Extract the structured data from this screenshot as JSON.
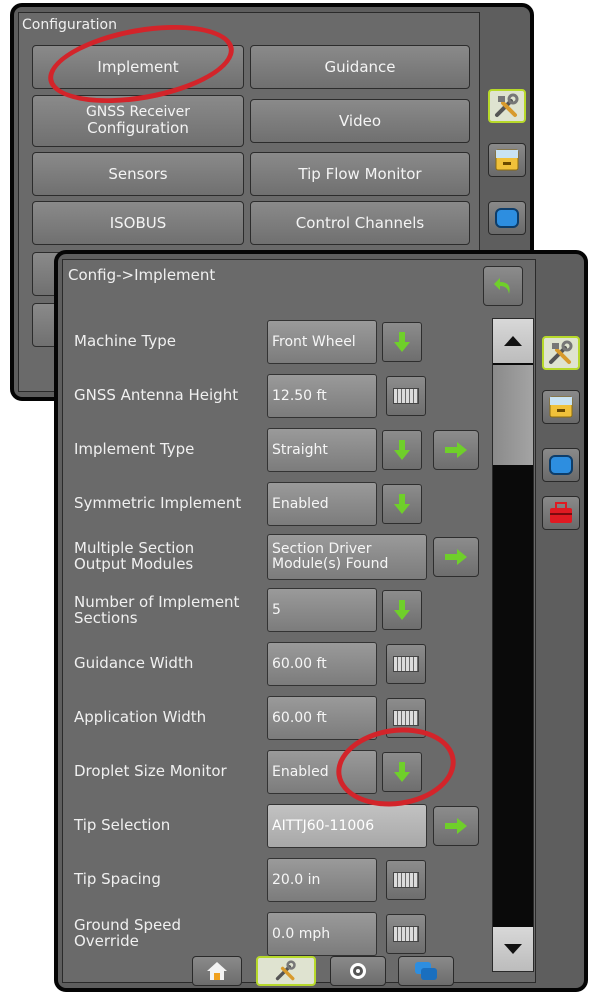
{
  "back_screen": {
    "title": "Configuration",
    "buttons": {
      "implement": "Implement",
      "guidance": "Guidance",
      "gnss_line1": "GNSS Receiver",
      "gnss_line2": "Configuration",
      "video": "Video",
      "sensors": "Sensors",
      "tip_flow_monitor": "Tip Flow Monitor",
      "isobus": "ISOBUS",
      "control_channels": "Control Channels"
    }
  },
  "front_screen": {
    "breadcrumb": "Config->Implement",
    "rows": [
      {
        "label": "Machine Type",
        "value": "Front Wheel"
      },
      {
        "label": "GNSS Antenna Height",
        "value": "12.50 ft"
      },
      {
        "label": "Implement Type",
        "value": "Straight"
      },
      {
        "label": "Symmetric Implement",
        "value": "Enabled"
      },
      {
        "label": "Multiple Section Output Modules",
        "value": "Section Driver Module(s) Found"
      },
      {
        "label": "Number of Implement Sections",
        "value": "5"
      },
      {
        "label": "Guidance Width",
        "value": "60.00 ft"
      },
      {
        "label": "Application Width",
        "value": "60.00 ft"
      },
      {
        "label": "Droplet Size Monitor",
        "value": "Enabled"
      },
      {
        "label": "Tip Selection",
        "value": "AITTJ60-11006"
      },
      {
        "label": "Tip Spacing",
        "value": "20.0 in"
      },
      {
        "label": "Ground Speed Override",
        "value": "0.0 mph"
      }
    ]
  },
  "colors": {
    "accent_green": "#6fcf2a",
    "callout_red": "#d3242a",
    "active_tab_border": "#b7d92a"
  }
}
